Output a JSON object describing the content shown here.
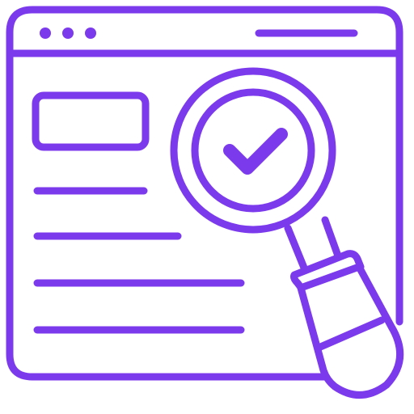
{
  "icon": {
    "name": "website-audit-icon",
    "colors": {
      "stroke": "#7C3AED",
      "background": "#FFFFFF"
    },
    "parts": [
      "browser-window-icon",
      "window-dots-icon",
      "address-bar-icon",
      "content-block-icon",
      "text-lines-icon",
      "magnifying-glass-icon",
      "checkmark-icon"
    ]
  }
}
